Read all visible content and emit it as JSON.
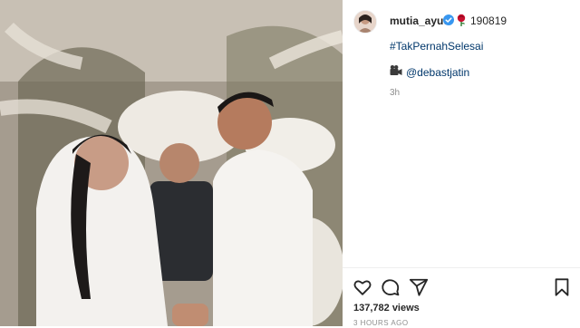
{
  "post": {
    "username": "mutia_ayuu",
    "caption_number": "190819",
    "hashtag": "#TakPernahSelesai",
    "mention": "@debastjatin",
    "timestamp": "3h",
    "views": "137,782 views",
    "time_ago": "3 HOURS AGO"
  },
  "icons": {
    "verified": "verified-badge-icon",
    "rose": "rose-emoji-icon",
    "camera": "movie-camera-emoji-icon",
    "like": "heart-icon",
    "comment": "comment-icon",
    "share": "share-icon",
    "save": "bookmark-icon"
  },
  "colors": {
    "link": "#00376b",
    "text": "#262626",
    "muted": "#8e8e8e",
    "verified": "#3897f0"
  }
}
